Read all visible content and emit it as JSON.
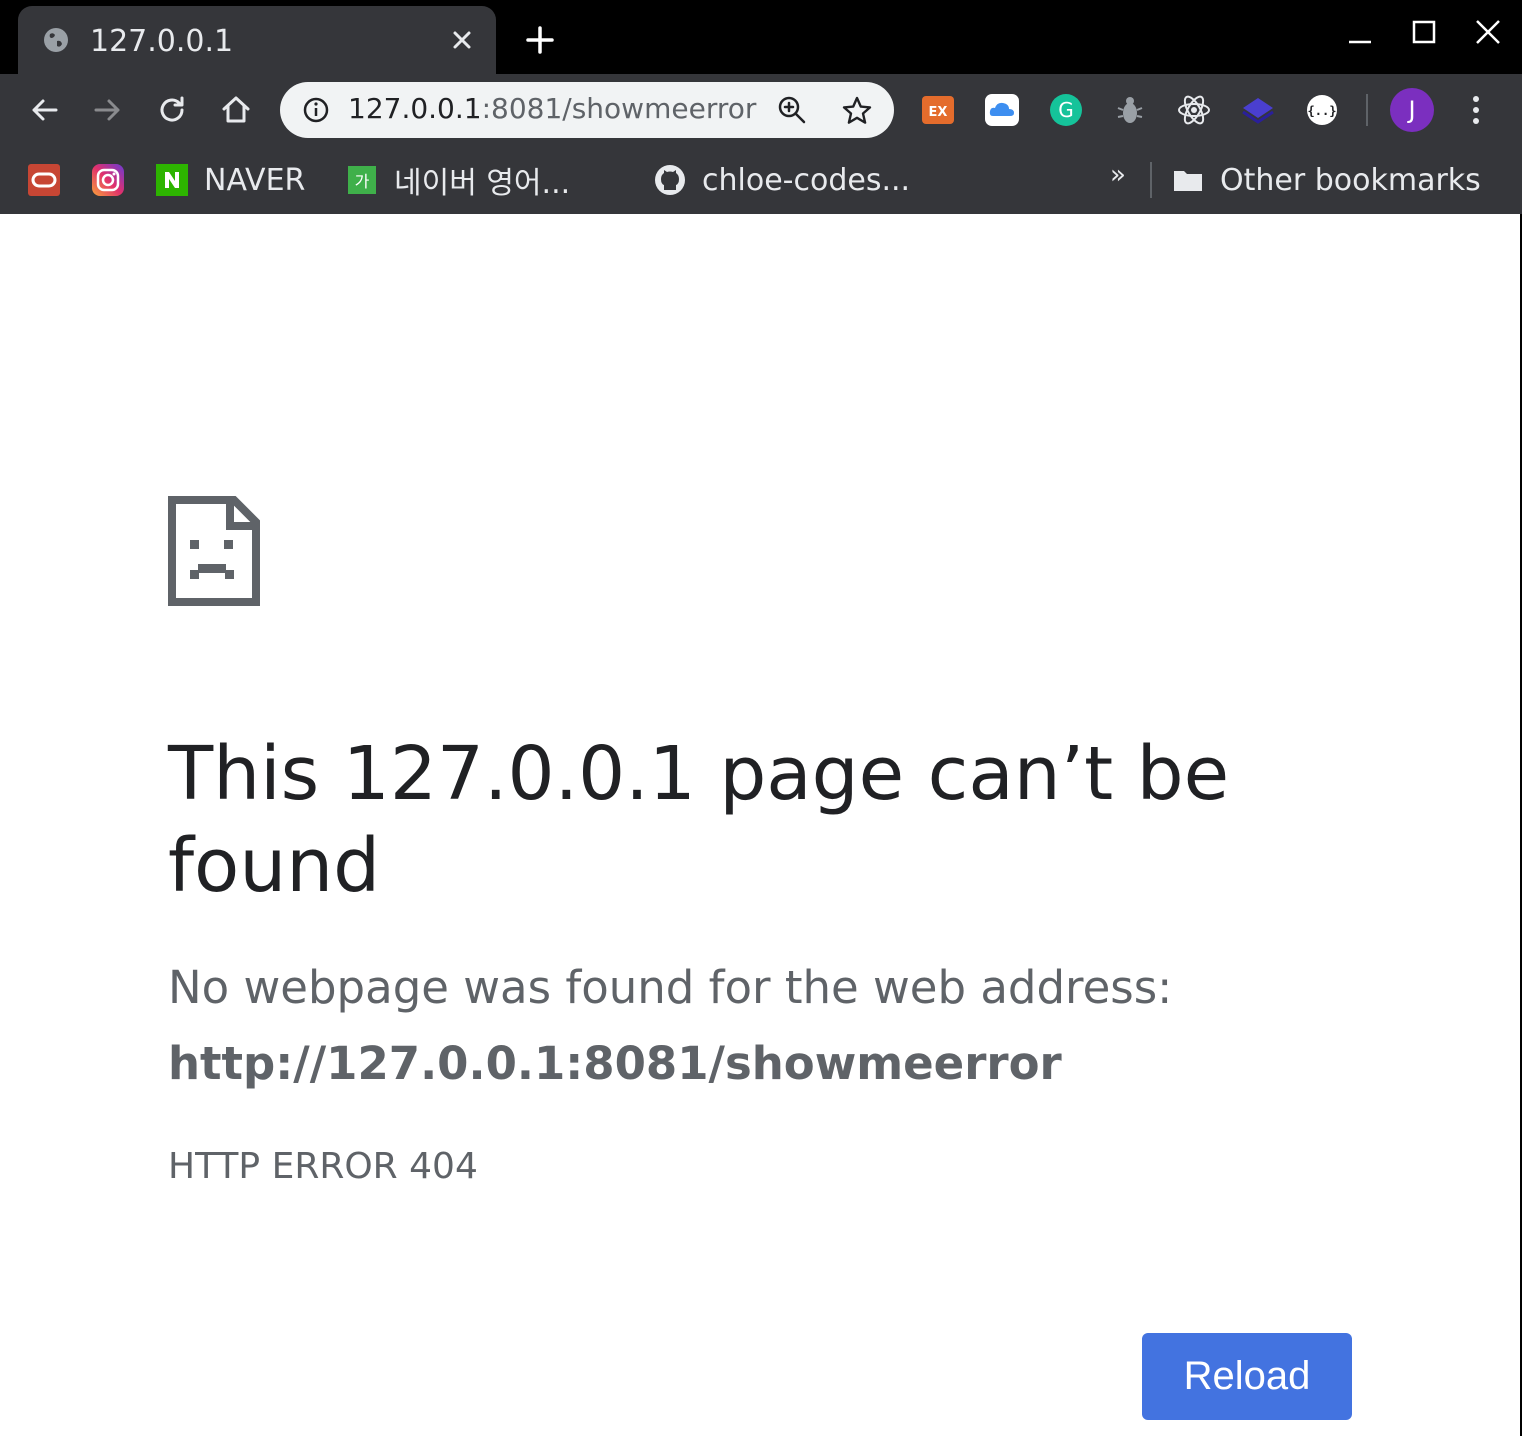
{
  "tab": {
    "title": "127.0.0.1",
    "favicon": "globe-icon"
  },
  "toolbar": {
    "url_host": "127.0.0.1",
    "url_rest": ":8081/showmeerror",
    "avatar_initial": "J",
    "extensions": [
      "ex-extension-icon",
      "icloud-icon",
      "grammarly-icon",
      "bug-icon",
      "react-icon",
      "layers-icon",
      "json-icon"
    ]
  },
  "bookmarks": {
    "items": [
      {
        "label": "",
        "icon": "oracle-icon"
      },
      {
        "label": "",
        "icon": "instagram-icon"
      },
      {
        "label": "NAVER",
        "icon": "naver-icon"
      },
      {
        "label": "네이버 영어...",
        "icon": "naver-dictionary-icon"
      },
      {
        "label": "chloe-codes...",
        "icon": "github-icon"
      }
    ],
    "overflow": "»",
    "other_label": "Other bookmarks"
  },
  "error_page": {
    "title": "This 127.0.0.1 page can’t be found",
    "description": "No webpage was found for the web address:",
    "url": "http://127.0.0.1:8081/showmeerror",
    "code": "HTTP ERROR 404",
    "reload_label": "Reload"
  },
  "colors": {
    "accent": "#4373e0",
    "toolbar": "#35363a",
    "text_primary": "#202124",
    "text_secondary": "#5f6368"
  }
}
